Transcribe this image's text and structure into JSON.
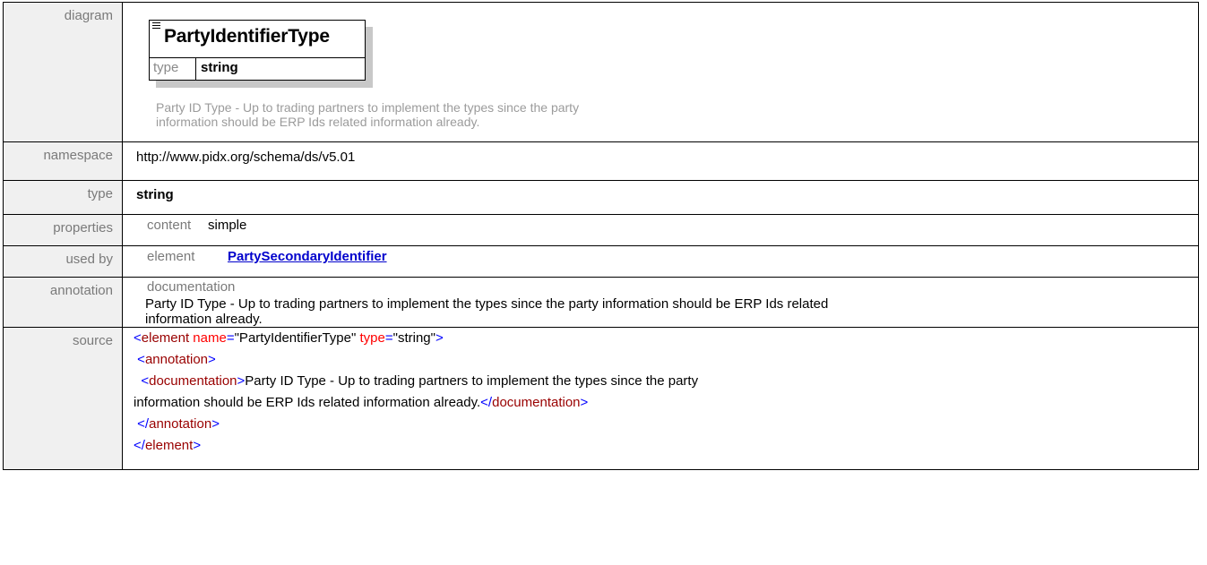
{
  "labels": {
    "diagram": "diagram",
    "namespace": "namespace",
    "type": "type",
    "properties": "properties",
    "used_by": "used by",
    "annotation": "annotation",
    "source": "source"
  },
  "diagram": {
    "name": "PartyIdentifierType",
    "type_label": "type",
    "type_value": "string",
    "doc_line1": "Party ID Type - Up to trading partners to implement the types since the party",
    "doc_line2": "information should be ERP Ids related information already."
  },
  "namespace": "http://www.pidx.org/schema/ds/v5.01",
  "type": "string",
  "properties": {
    "key": "content",
    "value": "simple"
  },
  "used_by": {
    "key": "element",
    "link": "PartySecondaryIdentifier"
  },
  "annotation": {
    "key": "documentation",
    "text_line1": "Party ID Type - Up to trading partners to implement the types since the party information should be ERP Ids related",
    "text_line2": "information already."
  },
  "source": {
    "line1": {
      "open": "<",
      "tag": "element",
      "attr1": " name",
      "eq1": "=",
      "val1": "\"PartyIdentifierType\"",
      "attr2": " type",
      "eq2": "=",
      "val2": "\"string\"",
      "close": ">"
    },
    "line2": {
      "indent": " ",
      "open": "<",
      "tag": "annotation",
      "close": ">"
    },
    "line3": {
      "indent": "  ",
      "open": "<",
      "tag": "documentation",
      "close": ">",
      "text": "Party ID Type - Up to trading partners to implement the types since the party"
    },
    "line4": {
      "text": "information should be ERP Ids related information already.",
      "open": "</",
      "tag": "documentation",
      "close": ">"
    },
    "line5": {
      "indent": " ",
      "open": "</",
      "tag": "annotation",
      "close": ">"
    },
    "line6": {
      "open": "</",
      "tag": "element",
      "close": ">"
    }
  },
  "colors": {
    "bracket": "#0000ff",
    "tag": "#990000",
    "attribute": "#ff0000",
    "link": "#0000cc",
    "label_bg": "#f0f0f0"
  }
}
